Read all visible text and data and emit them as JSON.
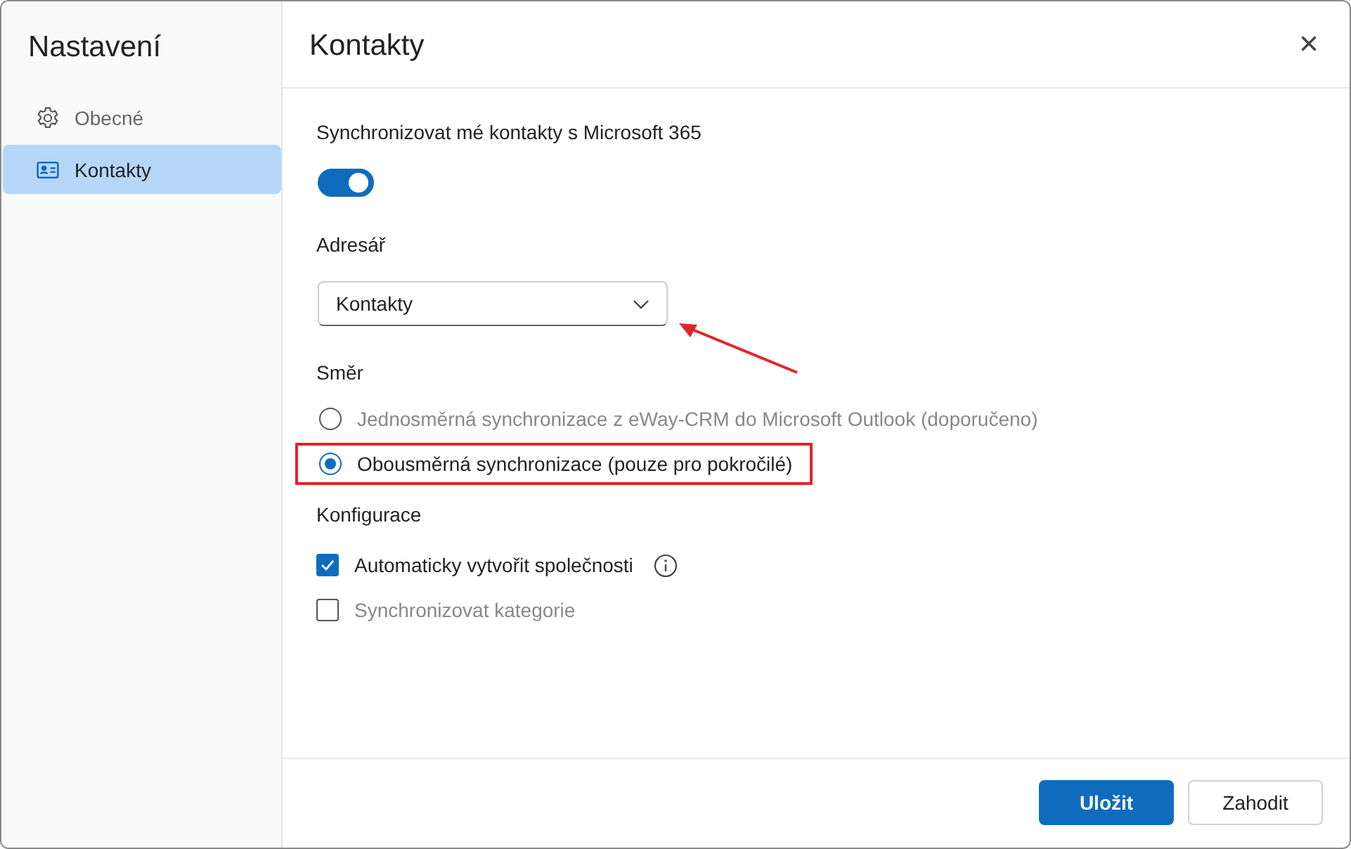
{
  "sidebar": {
    "title": "Nastavení",
    "items": [
      {
        "label": "Obecné",
        "kind": "gear",
        "selected": false
      },
      {
        "label": "Kontakty",
        "kind": "contact-card",
        "selected": true
      }
    ]
  },
  "panel": {
    "title": "Kontakty",
    "close": "×",
    "sync": {
      "label": "Synchronizovat mé kontakty s Microsoft 365",
      "on": true
    },
    "address_book": {
      "label": "Adresář",
      "value": "Kontakty"
    },
    "direction": {
      "label": "Směr",
      "options": [
        {
          "label": "Jednosměrná synchronizace z eWay-CRM do Microsoft Outlook (doporučeno)",
          "selected": false,
          "highlighted": false
        },
        {
          "label": "Obousměrná synchronizace (pouze pro pokročilé)",
          "selected": true,
          "highlighted": true
        }
      ]
    },
    "configuration": {
      "label": "Konfigurace",
      "options": [
        {
          "label": "Automaticky vytvořit společnosti",
          "checked": true,
          "info": true
        },
        {
          "label": "Synchronizovat kategorie",
          "checked": false,
          "info": false
        }
      ]
    },
    "annotations": [
      {
        "kind": "arrow",
        "color": "#e3242b"
      }
    ]
  },
  "footer": {
    "buttons": [
      {
        "label": "Uložit",
        "kind": "primary"
      },
      {
        "label": "Zahodit",
        "kind": "secondary"
      }
    ]
  }
}
